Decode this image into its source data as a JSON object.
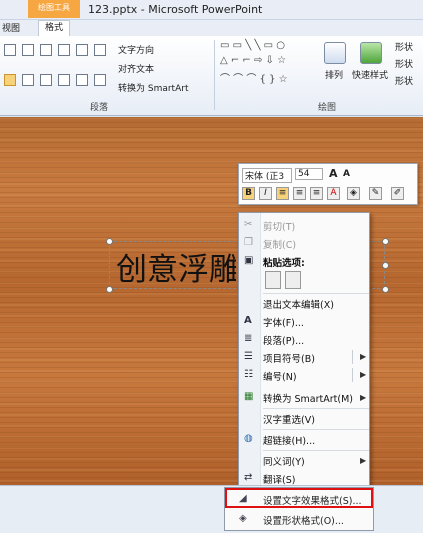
{
  "window": {
    "context_tab": "绘图工具",
    "title": "123.pptx - Microsoft PowerPoint"
  },
  "tabs": {
    "view": "视图",
    "format": "格式"
  },
  "ribbon": {
    "text_direction": "文字方向",
    "align_text": "对齐文本",
    "convert_smartart": "转换为 SmartArt",
    "arrange": "排列",
    "quick_styles": "快速样式",
    "shape_fill": "形状",
    "shape_outline": "形状",
    "shape_effects": "形状",
    "paragraph_group": "段落",
    "drawing_group": "绘图"
  },
  "slide": {
    "text": "创意浮雕"
  },
  "mini_toolbar": {
    "font": "宋体 (正3",
    "size": "54",
    "grow": "A",
    "shrink": "A"
  },
  "context_menu": {
    "items": [
      {
        "label": "剪切(T)",
        "icon": "scissors",
        "disabled": true
      },
      {
        "label": "复制(C)",
        "icon": "copy",
        "disabled": true
      },
      {
        "label": "粘贴选项:",
        "icon": "paste",
        "disabled": false
      },
      {
        "label": "退出文本编辑(X)",
        "icon": "",
        "disabled": false
      },
      {
        "label": "字体(F)...",
        "icon": "A",
        "disabled": false
      },
      {
        "label": "段落(P)...",
        "icon": "paragraph",
        "disabled": false
      },
      {
        "label": "项目符号(B)",
        "icon": "bullets",
        "disabled": false
      },
      {
        "label": "编号(N)",
        "icon": "numbering",
        "disabled": false
      },
      {
        "label": "转换为 SmartArt(M)",
        "icon": "smartart",
        "disabled": false
      },
      {
        "label": "汉字重选(V)",
        "icon": "",
        "disabled": false
      },
      {
        "label": "超链接(H)...",
        "icon": "globe",
        "disabled": false
      },
      {
        "label": "同义词(Y)",
        "icon": "",
        "disabled": false
      },
      {
        "label": "翻译(S)",
        "icon": "translate",
        "disabled": false
      }
    ]
  },
  "submenu": {
    "format_text_effects": "设置文字效果格式(S)...",
    "format_shape": "设置形状格式(O)..."
  }
}
